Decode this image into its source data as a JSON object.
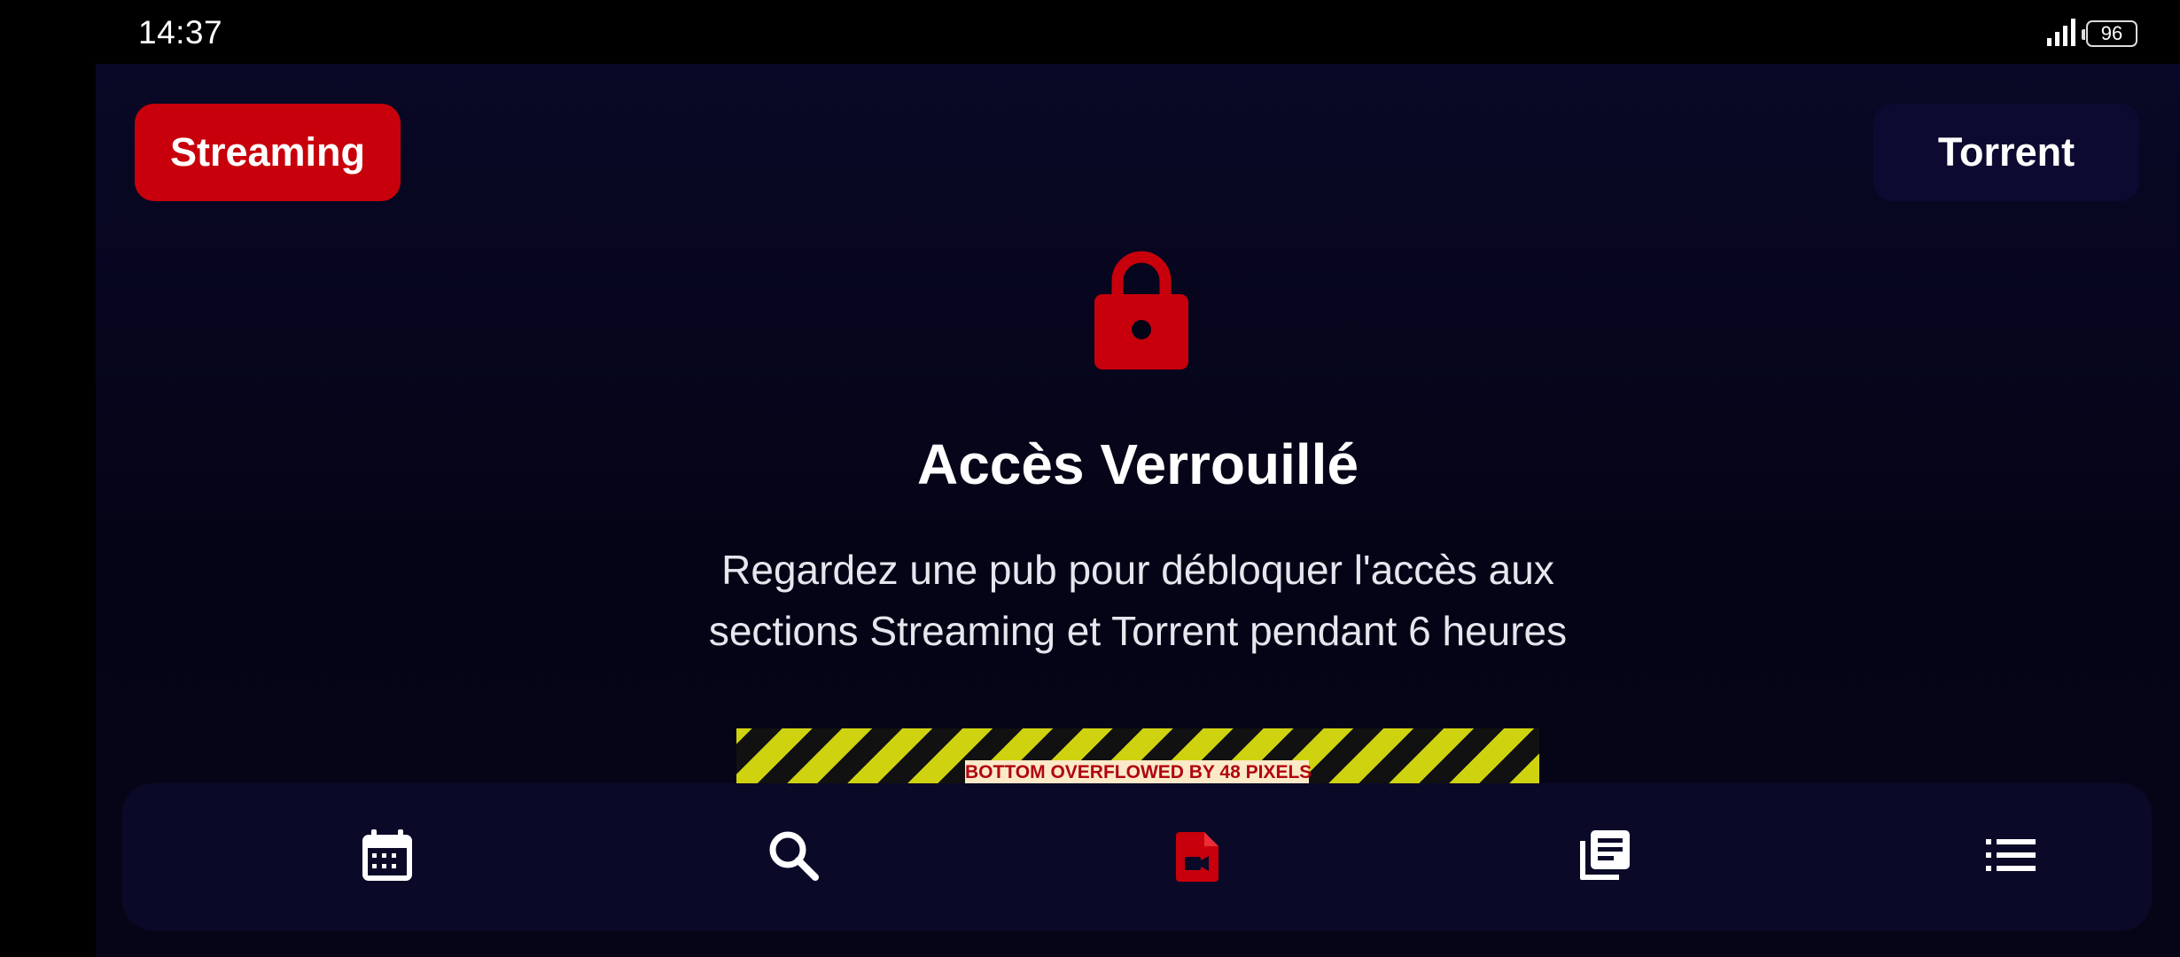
{
  "status_bar": {
    "time": "14:37",
    "battery_level": "96",
    "icons": [
      "signal-icon",
      "battery-icon"
    ]
  },
  "top_buttons": {
    "streaming_label": "Streaming",
    "torrent_label": "Torrent"
  },
  "lock_panel": {
    "icon": "lock-icon",
    "title": "Accès Verrouillé",
    "message": "Regardez une pub pour débloquer l'accès aux sections Streaming et Torrent pendant 6 heures"
  },
  "overflow_warning": {
    "label": "BOTTOM OVERFLOWED BY 48 PIXELS"
  },
  "bottom_nav": {
    "items": [
      {
        "icon": "calendar-icon",
        "active": false
      },
      {
        "icon": "search-icon",
        "active": false
      },
      {
        "icon": "video-file-icon",
        "active": true
      },
      {
        "icon": "library-icon",
        "active": false
      },
      {
        "icon": "list-icon",
        "active": false
      }
    ]
  },
  "colors": {
    "accent": "#c8000b",
    "background": "#050416",
    "nav_background": "#0b0928",
    "warning_stripe": "#cfd20f"
  }
}
